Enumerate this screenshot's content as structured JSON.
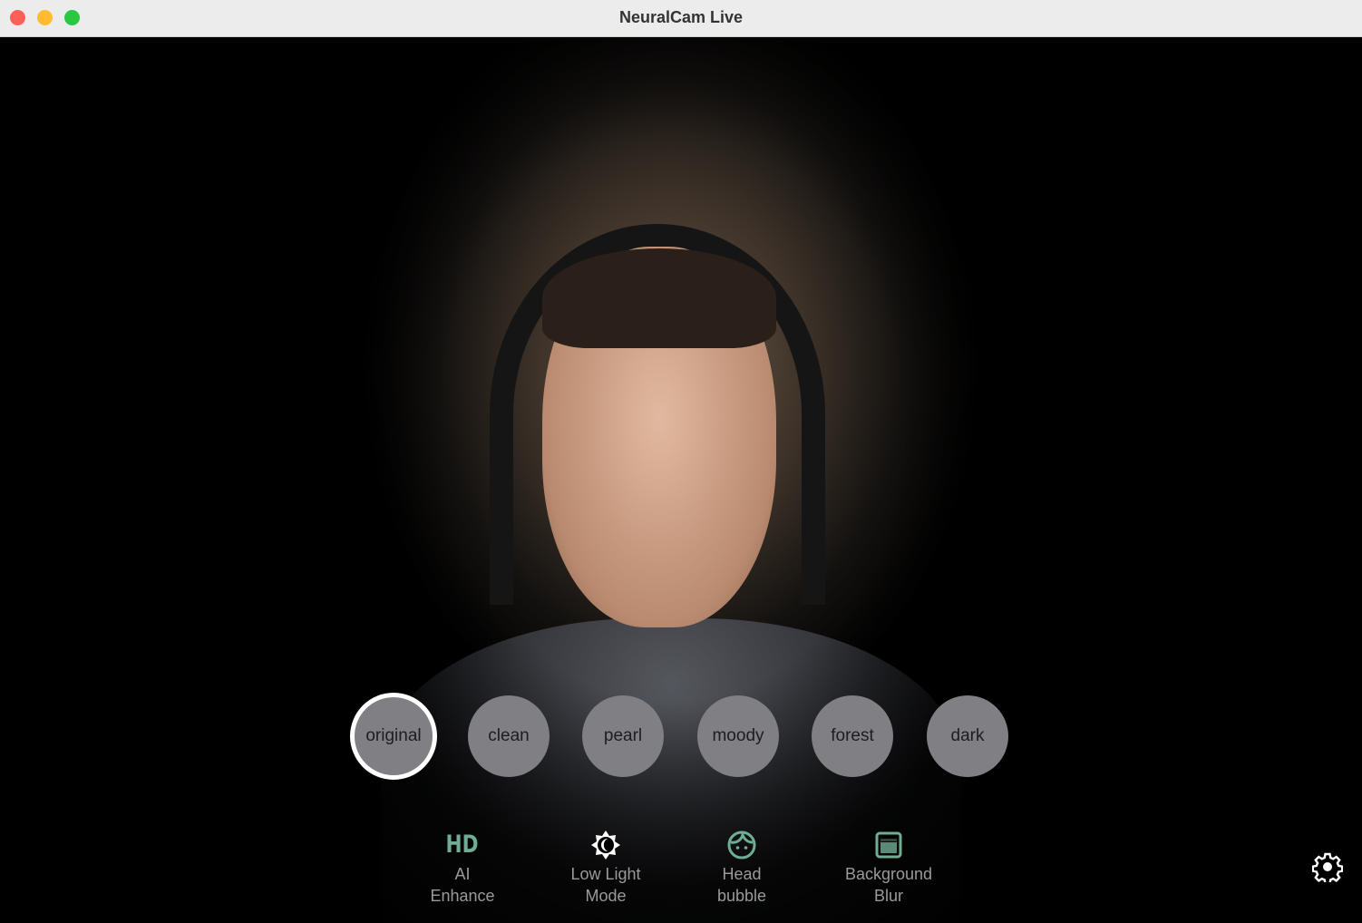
{
  "window": {
    "title": "NeuralCam Live"
  },
  "filters": [
    {
      "label": "original",
      "selected": true
    },
    {
      "label": "clean",
      "selected": false
    },
    {
      "label": "pearl",
      "selected": false
    },
    {
      "label": "moody",
      "selected": false
    },
    {
      "label": "forest",
      "selected": false
    },
    {
      "label": "dark",
      "selected": false
    }
  ],
  "toolbar": [
    {
      "icon": "hd-icon",
      "icon_text": "HD",
      "line1": "AI",
      "line2": "Enhance",
      "active": true
    },
    {
      "icon": "low-light-moon-icon",
      "line1": "Low Light",
      "line2": "Mode",
      "active": false
    },
    {
      "icon": "face-icon",
      "line1": "Head",
      "line2": "bubble",
      "active": true
    },
    {
      "icon": "background-blur-icon",
      "line1": "Background",
      "line2": "Blur",
      "active": true
    }
  ],
  "colors": {
    "accent": "#6fae94",
    "filter_bg": "#808084",
    "inactive_icon": "#ffffff"
  }
}
